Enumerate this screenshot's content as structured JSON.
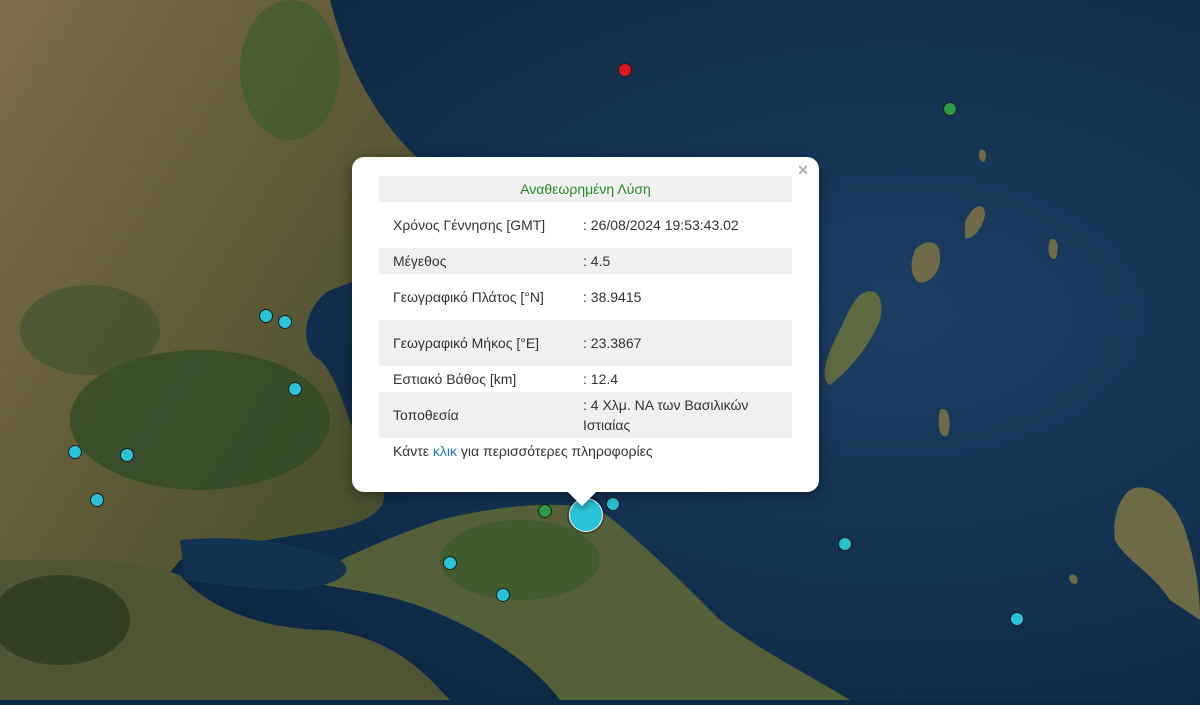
{
  "popup": {
    "title": "Αναθεωρημένη Λύση",
    "close_symbol": "×",
    "rows": [
      {
        "label": "Χρόνος Γέννησης [GMT]",
        "value": ": 26/08/2024 19:53:43.02"
      },
      {
        "label": "Μέγεθος",
        "value": ": 4.5"
      },
      {
        "label": "Γεωγραφικό Πλάτος [°N]",
        "value": ": 38.9415"
      },
      {
        "label": "Γεωγραφικό Μήκος [°E]",
        "value": ": 23.3867"
      },
      {
        "label": "Εστιακό Βάθος [km]",
        "value": ": 12.4"
      },
      {
        "label": "Τοποθεσία",
        "value": ": 4 Χλμ. ΝΑ των Βασιλικών Ιστιαίας"
      }
    ],
    "more_prefix": "Κάντε ",
    "more_link": "κλικ",
    "more_suffix": " για περισσότερες πληροφορίες"
  },
  "colors": {
    "sea": "#0f2c4a",
    "land": "#6b6442",
    "forest": "#2f4a25",
    "marker_recent": "#29c3d8",
    "marker_green": "#2e9a46",
    "marker_red": "#e0141e",
    "title_green": "#2a8a2a",
    "link_blue": "#1a73c8"
  }
}
